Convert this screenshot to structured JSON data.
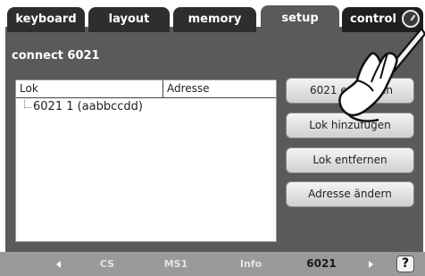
{
  "tabs": [
    {
      "label": "keyboard"
    },
    {
      "label": "layout"
    },
    {
      "label": "memory"
    },
    {
      "label": "setup"
    },
    {
      "label": "control"
    }
  ],
  "active_tab": "setup",
  "page_title": "connect 6021",
  "table": {
    "columns": [
      "Lok",
      "Adresse"
    ],
    "rows": [
      {
        "lok": "6021 1 (aabbccdd)",
        "adresse": ""
      }
    ]
  },
  "buttons": {
    "b1": "6021 entfernen",
    "b2": "Lok hinzufügen",
    "b3": "Lok entfernen",
    "b4": "Adresse ändern"
  },
  "bottom_nav": {
    "items": [
      "CS",
      "MS1",
      "Info",
      "6021"
    ],
    "active": "6021",
    "help": "?"
  },
  "icons": [
    "clock-icon",
    "arrow-left-icon",
    "arrow-right-icon",
    "help-icon",
    "hand-pen-icon"
  ],
  "colors": {
    "tab_bg": "#2e2e2e",
    "panel_bg": "#5a5a5a",
    "bottom_bar": "#9a9a9a"
  }
}
